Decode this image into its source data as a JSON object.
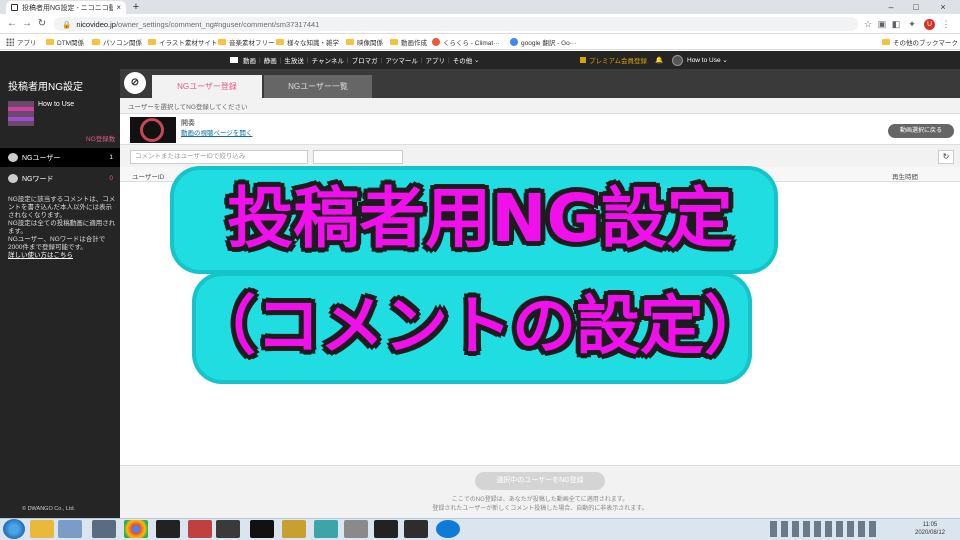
{
  "browser": {
    "tab_title": "投稿者用NG設定 - ニコニコ動画",
    "url_host": "nicovideo.jp",
    "url_path": "/owner_settings/comment_ng#nguser/comment/sm37317441",
    "profile_initial": "U"
  },
  "bookmarks": [
    "アプリ",
    "DTM関係",
    "パソコン関係",
    "イラスト素材サイト",
    "音楽素材フリー",
    "様々な知識・雑学",
    "映像関係",
    "動画作成",
    "くらくら - Climat···",
    "google 翻訳 - Go···"
  ],
  "bookmarks_other": "その他のブックマーク",
  "nico_menu": [
    "動画",
    "静画",
    "生放送",
    "チャンネル",
    "ブロマガ",
    "アツマール",
    "アプリ",
    "その他"
  ],
  "nico_right": {
    "premium": "プレミアム会員登録",
    "user": "How to Use"
  },
  "sidebar": {
    "title": "投稿者用NG設定",
    "username": "How to Use",
    "ng_count_label": "NG登録数",
    "items": [
      {
        "label": "NGユーザー",
        "count": "1"
      },
      {
        "label": "NGワード",
        "count": "0"
      }
    ],
    "desc1": "NG設定に該当するコメントは、コメントを書き込んだ本人以外には表示されなくなります。",
    "desc2": "NG設定は全ての投稿動画に適用されます。",
    "desc3": "NGユーザー、NGワードは合計で2000件まで登録可能です。",
    "help_link": "詳しい使い方はこちら",
    "copyright": "© DWANGO Co., Ltd."
  },
  "main": {
    "tabs": [
      "NGユーザー登録",
      "NGユーザー一覧"
    ],
    "instruction": "ユーザーを選択してNG登録してください",
    "video_title": "開奏",
    "video_link": "動画の視聴ページを開く",
    "back_button": "動画選択に戻る",
    "search_placeholder": "コメントまたはユーザーIDで絞り込み",
    "col_user_id": "ユーザーID",
    "col_play_time": "再生時間",
    "register_button": "選択中のユーザーをNG登録",
    "footer1": "ここでのNG登録は、あなたが投稿した動画全てに適用されます。",
    "footer2": "登録されたユーザーが新しくコメント投稿した場合、自動的に非表示されます。"
  },
  "overlay": {
    "line1": "投稿者用NG設定",
    "line2": "（コメントの設定）",
    "color": "#f010ec",
    "outline": "#1fdde0"
  },
  "taskbar": {
    "time": "11:05",
    "date": "2020/08/12"
  }
}
